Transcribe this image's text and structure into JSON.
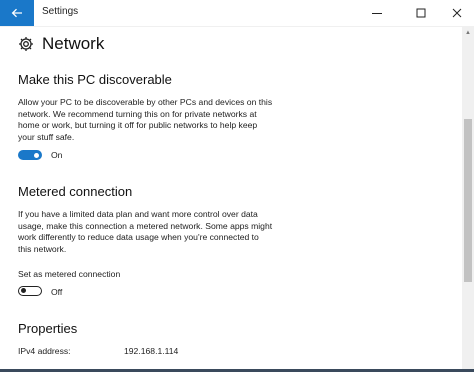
{
  "window": {
    "title": "Settings"
  },
  "page": {
    "title": "Network",
    "icon": "gear-icon"
  },
  "discoverable": {
    "heading": "Make this PC discoverable",
    "description_lines": [
      "Allow your PC to be discoverable by other PCs and devices on this",
      "network. We recommend turning this on for private networks at",
      "home or work, but turning it off for public networks to help keep",
      "your stuff safe."
    ],
    "toggle_state": "On"
  },
  "metered": {
    "heading": "Metered connection",
    "description_lines": [
      "If you have a limited data plan and want more control over data",
      "usage, make this connection a metered network. Some apps might",
      "work differently to reduce data usage when you're connected to",
      "this network."
    ],
    "setting_label": "Set as metered connection",
    "toggle_state": "Off"
  },
  "properties": {
    "heading": "Properties",
    "rows": [
      {
        "label": "IPv4 address:",
        "value": "192.168.1.114"
      }
    ]
  },
  "colors": {
    "accent": "#1a78c9"
  }
}
